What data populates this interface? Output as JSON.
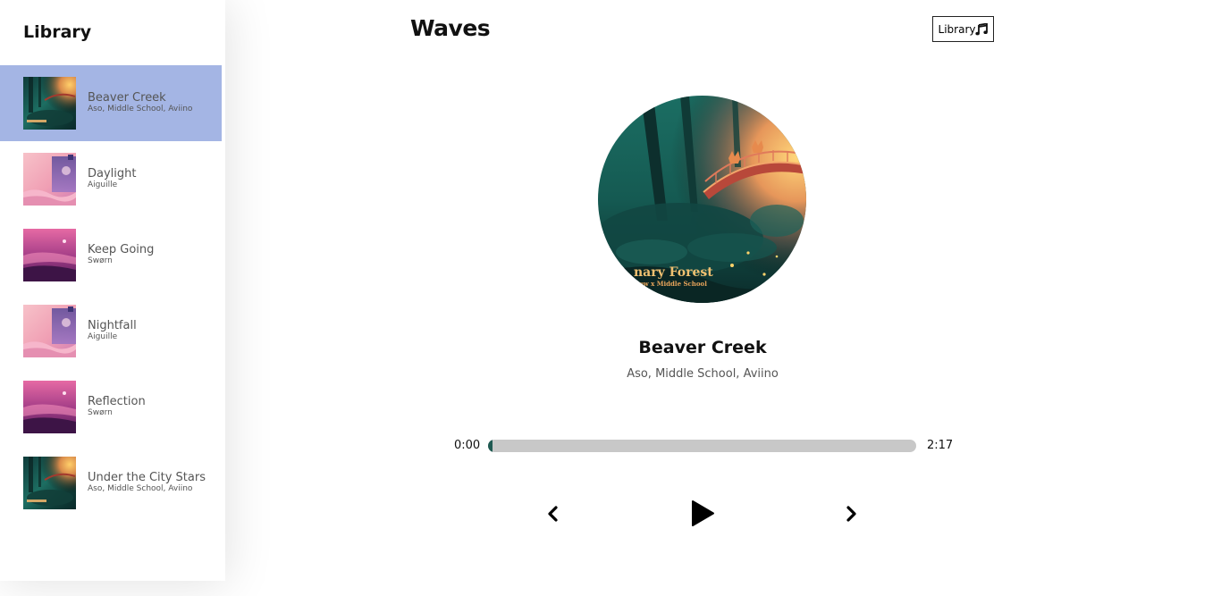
{
  "app": {
    "title": "Waves"
  },
  "header": {
    "library_button_label": "Library"
  },
  "library": {
    "heading": "Library",
    "songs": [
      {
        "title": "Beaver Creek",
        "artist": "Aso, Middle School, Aviino",
        "cover": "forest",
        "selected": true
      },
      {
        "title": "Daylight",
        "artist": "Aiguille",
        "cover": "pink",
        "selected": false
      },
      {
        "title": "Keep Going",
        "artist": "Swørn",
        "cover": "magenta",
        "selected": false
      },
      {
        "title": "Nightfall",
        "artist": "Aiguille",
        "cover": "pink",
        "selected": false
      },
      {
        "title": "Reflection",
        "artist": "Swørn",
        "cover": "magenta",
        "selected": false
      },
      {
        "title": "Under the City Stars",
        "artist": "Aso, Middle School, Aviino",
        "cover": "forest",
        "selected": false
      }
    ]
  },
  "player": {
    "title": "Beaver Creek",
    "artist": "Aso, Middle School, Aviino",
    "current_time": "0:00",
    "duration": "2:17",
    "progress": 0.01,
    "cover_text": "nary Forest",
    "cover_subtext": "illow x Middle School"
  },
  "colors": {
    "selected_bg": "#a4b5e4",
    "track_bg": "#c8c8c8",
    "track_fill": "#1f5a52"
  },
  "icons": {
    "library_button": "music-note-icon",
    "prev": "chevron-left-icon",
    "play": "play-icon",
    "next": "chevron-right-icon"
  }
}
